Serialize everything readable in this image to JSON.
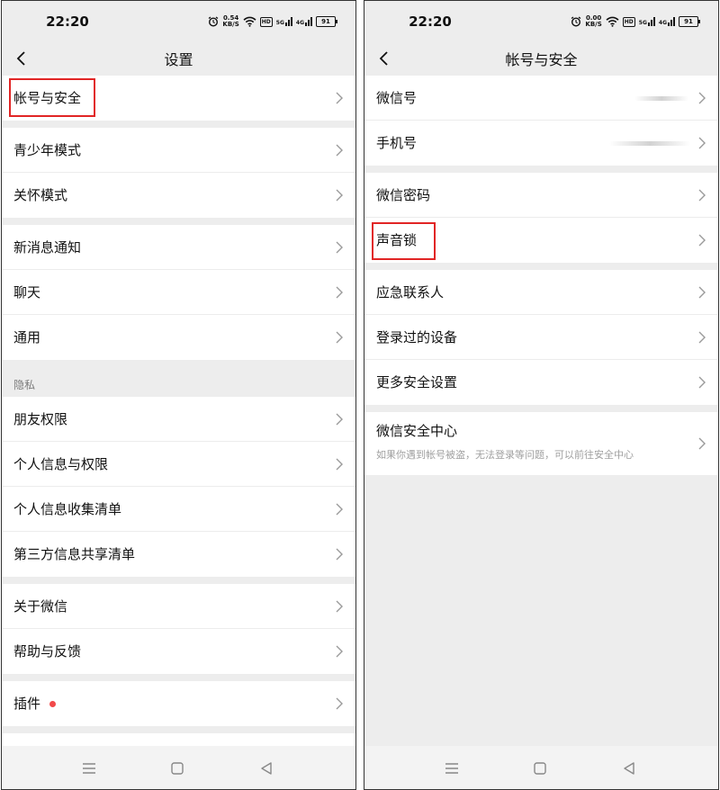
{
  "status_bar": {
    "time": "22:20",
    "left_speed_value": "0.54",
    "right_speed_value": "0.00",
    "speed_unit": "KB/S",
    "hd_label": "HD",
    "network_label_1": "5G",
    "network_label_2": "4G",
    "battery_level": "91"
  },
  "left_screen": {
    "title": "设置",
    "section_privacy_label": "隐私",
    "items": [
      "帐号与安全",
      "青少年模式",
      "关怀模式",
      "新消息通知",
      "聊天",
      "通用",
      "朋友权限",
      "个人信息与权限",
      "个人信息收集清单",
      "第三方信息共享清单",
      "关于微信",
      "帮助与反馈",
      "插件"
    ]
  },
  "right_screen": {
    "title": "帐号与安全",
    "items": [
      "微信号",
      "手机号",
      "微信密码",
      "声音锁",
      "应急联系人",
      "登录过的设备",
      "更多安全设置"
    ],
    "security_center": {
      "title": "微信安全中心",
      "subtitle": "如果你遇到帐号被盗，无法登录等问题，可以前往安全中心"
    }
  },
  "colors": {
    "background": "#ededed",
    "item_background": "#ffffff",
    "highlight_border": "#e12525",
    "notification_dot": "#f2494a"
  },
  "icons": [
    "back-arrow-icon",
    "chevron-right-icon",
    "alarm-icon",
    "wifi-icon",
    "hd-icon",
    "signal-icon",
    "battery-icon",
    "menu-icon",
    "home-square-icon",
    "back-triangle-icon"
  ]
}
